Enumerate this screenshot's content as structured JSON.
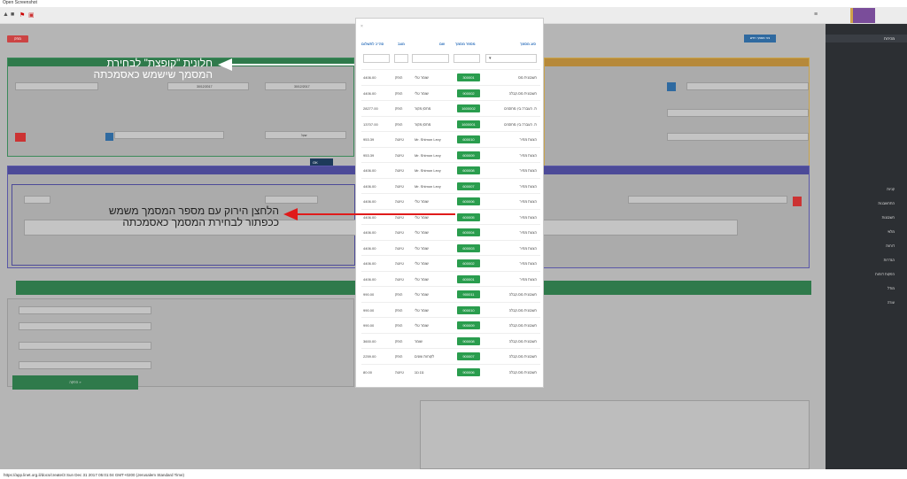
{
  "window_title": "Open Screenshot",
  "status_url": "https://app.linet.org.il/docs/create/3 Sun Dec 31 2017 05:01:04 GMT+0200 (Jerusalem Standard Time)",
  "modal": {
    "close": "×",
    "headers": [
      "סוג מסמך",
      "מספר מסמך",
      "שם",
      "מצב",
      "סה\"כ לתשלום"
    ],
    "filter_select": "▾",
    "rows": [
      {
        "type": "חשבונית מס",
        "num": "300001",
        "name": "שומר טלי",
        "status": "הופק",
        "total": "4406.00"
      },
      {
        "type": "חשבונית מס-קבלה",
        "num": "900002",
        "name": "שומר טלי",
        "status": "הופק",
        "total": "4406.00"
      },
      {
        "type": "ת. העברה בין מחסנים",
        "num": "1600002",
        "name": "מחסן מקור",
        "status": "הופק",
        "total": "28277.00"
      },
      {
        "type": "ת. העברה בין מחסנים",
        "num": "1600001",
        "name": "מחסן מקור",
        "status": "הופק",
        "total": "13707.00"
      },
      {
        "type": "הצעת מחיר",
        "num": "600010",
        "name": "Mr. Shlmon Levy",
        "status": "טיוטה",
        "total": "953.39"
      },
      {
        "type": "הצעת מחיר",
        "num": "600009",
        "name": "Mr. Shlmon Levy",
        "status": "טיוטה",
        "total": "953.39"
      },
      {
        "type": "הצעת מחיר",
        "num": "600008",
        "name": "Mr. Shlmon Levy",
        "status": "טיוטה",
        "total": "4406.00"
      },
      {
        "type": "הצעת מחיר",
        "num": "600007",
        "name": "Mr. Shlmon Levy",
        "status": "טיוטה",
        "total": "4406.00"
      },
      {
        "type": "הצעת מחיר",
        "num": "600006",
        "name": "שומר טלי",
        "status": "טיוטה",
        "total": "4406.00"
      },
      {
        "type": "הצעת מחיר",
        "num": "600005",
        "name": "שומר טלי",
        "status": "טיוטה",
        "total": "4406.00"
      },
      {
        "type": "הצעת מחיר",
        "num": "600004",
        "name": "שומר טלי",
        "status": "טיוטה",
        "total": "4406.00"
      },
      {
        "type": "הצעת מחיר",
        "num": "600003",
        "name": "שומר טלי",
        "status": "טיוטה",
        "total": "4406.00"
      },
      {
        "type": "הצעת מחיר",
        "num": "600002",
        "name": "שומר טלי",
        "status": "טיוטה",
        "total": "4406.00"
      },
      {
        "type": "הצעת מחיר",
        "num": "600001",
        "name": "שומר טלי",
        "status": "טיוטה",
        "total": "4406.00"
      },
      {
        "type": "חשבונית מס-קבלה",
        "num": "900011",
        "name": "שומר טלי",
        "status": "הופק",
        "total": "990.00"
      },
      {
        "type": "חשבונית מס-קבלה",
        "num": "900010",
        "name": "שומר טלי",
        "status": "הופק",
        "total": "990.00"
      },
      {
        "type": "חשבונית מס-קבלה",
        "num": "900009",
        "name": "שומר טלי",
        "status": "הופק",
        "total": "990.00"
      },
      {
        "type": "חשבונית מס-קבלה",
        "num": "900008",
        "name": "שומר",
        "status": "הופק",
        "total": "3600.00"
      },
      {
        "type": "חשבונית מס-קבלה",
        "num": "900007",
        "name": "לקוחות שונים",
        "status": "הופק",
        "total": "2259.00"
      },
      {
        "type": "חשבונית מס-קבלה",
        "num": "900006",
        "name": "נננ נננ",
        "status": "טיוטה",
        "total": "80.00"
      }
    ]
  },
  "annotations": {
    "top_line1": "חלונית \"קופצת\" לבחירת",
    "top_line2": "המסמך שישמש כאסמכתה",
    "mid_line1": "הלחצן הירוק עם מספר המסמך משמש",
    "mid_line2": "ככפתור לבחירת המסמך כאסמכתה",
    "arrow_top_color": "#ffffff",
    "arrow_mid_color": "#e01b1b"
  },
  "background": {
    "date1": "30/12/2017",
    "date2": "30/12/2017",
    "ok_label": "OK",
    "currency": "שקל",
    "total_btn": "הפקה »",
    "new_doc_btn": "צור מסמך חדש",
    "delete_btn": "מחק"
  },
  "sidebar": {
    "groups": [
      "מכירות",
      "קניות",
      "התחשבנות",
      "חשבונות",
      "מלאי",
      "דוחות",
      "הגדרות",
      "הפקות דוחות",
      "מודל",
      "עזרה"
    ]
  }
}
